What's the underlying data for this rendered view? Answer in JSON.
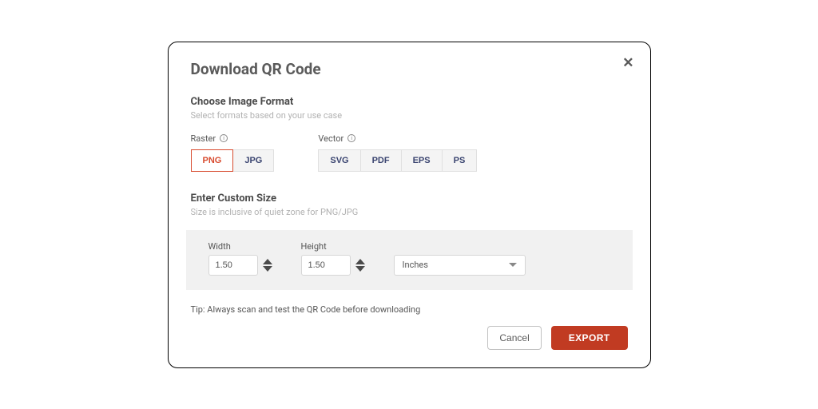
{
  "dialog": {
    "title": "Download QR Code",
    "tip": "Tip: Always scan and test the QR Code before downloading"
  },
  "format": {
    "title": "Choose Image Format",
    "subtitle": "Select formats based on your use case",
    "raster": {
      "label": "Raster",
      "options": [
        "PNG",
        "JPG"
      ],
      "selected": "PNG"
    },
    "vector": {
      "label": "Vector",
      "options": [
        "SVG",
        "PDF",
        "EPS",
        "PS"
      ]
    }
  },
  "size": {
    "title": "Enter Custom Size",
    "subtitle": "Size is inclusive of quiet zone for PNG/JPG",
    "width_label": "Width",
    "width_value": "1.50",
    "height_label": "Height",
    "height_value": "1.50",
    "unit_selected": "Inches"
  },
  "actions": {
    "cancel": "Cancel",
    "export": "EXPORT"
  }
}
